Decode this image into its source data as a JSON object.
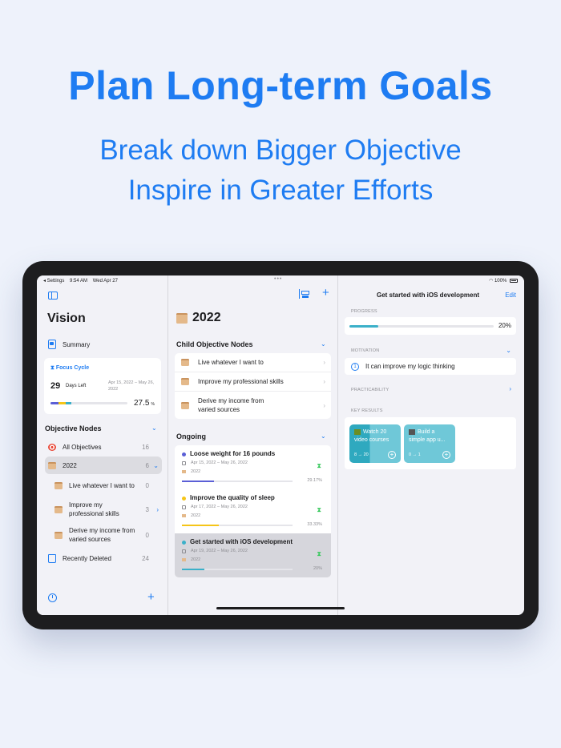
{
  "headline": "Plan Long-term Goals",
  "subline1": "Break down Bigger Objective",
  "subline2": "Inspire in Greater Efforts",
  "status": {
    "back": "◂ Settings",
    "time": "9:54 AM",
    "date": "Wed Apr 27",
    "battery": "100%"
  },
  "sidebar": {
    "title": "Vision",
    "summary": "Summary",
    "focus": {
      "title": "Focus Cycle",
      "days": "29",
      "days_label": "Days Left",
      "date_range": "Apr 15, 2022 – May 26, 2022",
      "percent": "27.5",
      "percent_unit": "%",
      "progress_segments": [
        {
          "color": "#5b5fd6",
          "fraction": 0.1
        },
        {
          "color": "#f5c518",
          "fraction": 0.1
        },
        {
          "color": "#3bb0c9",
          "fraction": 0.075
        }
      ]
    },
    "nodes_header": "Objective Nodes",
    "items": [
      {
        "label": "All Objectives",
        "count": "16"
      },
      {
        "label": "2022",
        "count": "6"
      }
    ],
    "sub_items": [
      {
        "label": "Live whatever I want to",
        "count": "0"
      },
      {
        "label": "Improve my professional skills",
        "count": "3"
      },
      {
        "label": "Derive my income from varied sources",
        "count": "0"
      }
    ],
    "deleted": {
      "label": "Recently Deleted",
      "count": "24"
    }
  },
  "middle": {
    "title": "2022",
    "child_header": "Child Objective Nodes",
    "children": [
      {
        "label": "Live whatever I want to"
      },
      {
        "label": "Improve my professional skills"
      },
      {
        "label": "Derive my income from varied sources"
      }
    ],
    "ongoing_header": "Ongoing",
    "goals": [
      {
        "title": "Loose weight for 16 pounds",
        "date": "Apr 15, 2022 – May 26, 2022",
        "year": "2022",
        "percent": "29.17%",
        "progress": 0.2917,
        "color": "#5b5fd6"
      },
      {
        "title": "Improve the quality of sleep",
        "date": "Apr 17, 2022 – May 26, 2022",
        "year": "2022",
        "percent": "33.33%",
        "progress": 0.3333,
        "color": "#f5c518"
      },
      {
        "title": "Get started with iOS development",
        "date": "Apr 19, 2022 – May 26, 2022",
        "year": "2022",
        "percent": "20%",
        "progress": 0.2,
        "color": "#3bb0c9"
      }
    ]
  },
  "detail": {
    "title": "Get started with iOS development",
    "edit": "Edit",
    "progress_label": "PROGRESS",
    "progress_pct": "20%",
    "progress": 0.2,
    "motivation_label": "MOTIVATION",
    "motivation_num": "1",
    "motivation_text": "It can improve my logic thinking",
    "practicability_label": "PRACTICABILITY",
    "key_results_label": "KEY RESULTS",
    "key_results": [
      {
        "title": "Watch 20 video courses",
        "range": "8 → 20",
        "progress": 0.4
      },
      {
        "title": "Build a simple app u...",
        "range": "0 → 1",
        "progress": 0
      }
    ]
  }
}
